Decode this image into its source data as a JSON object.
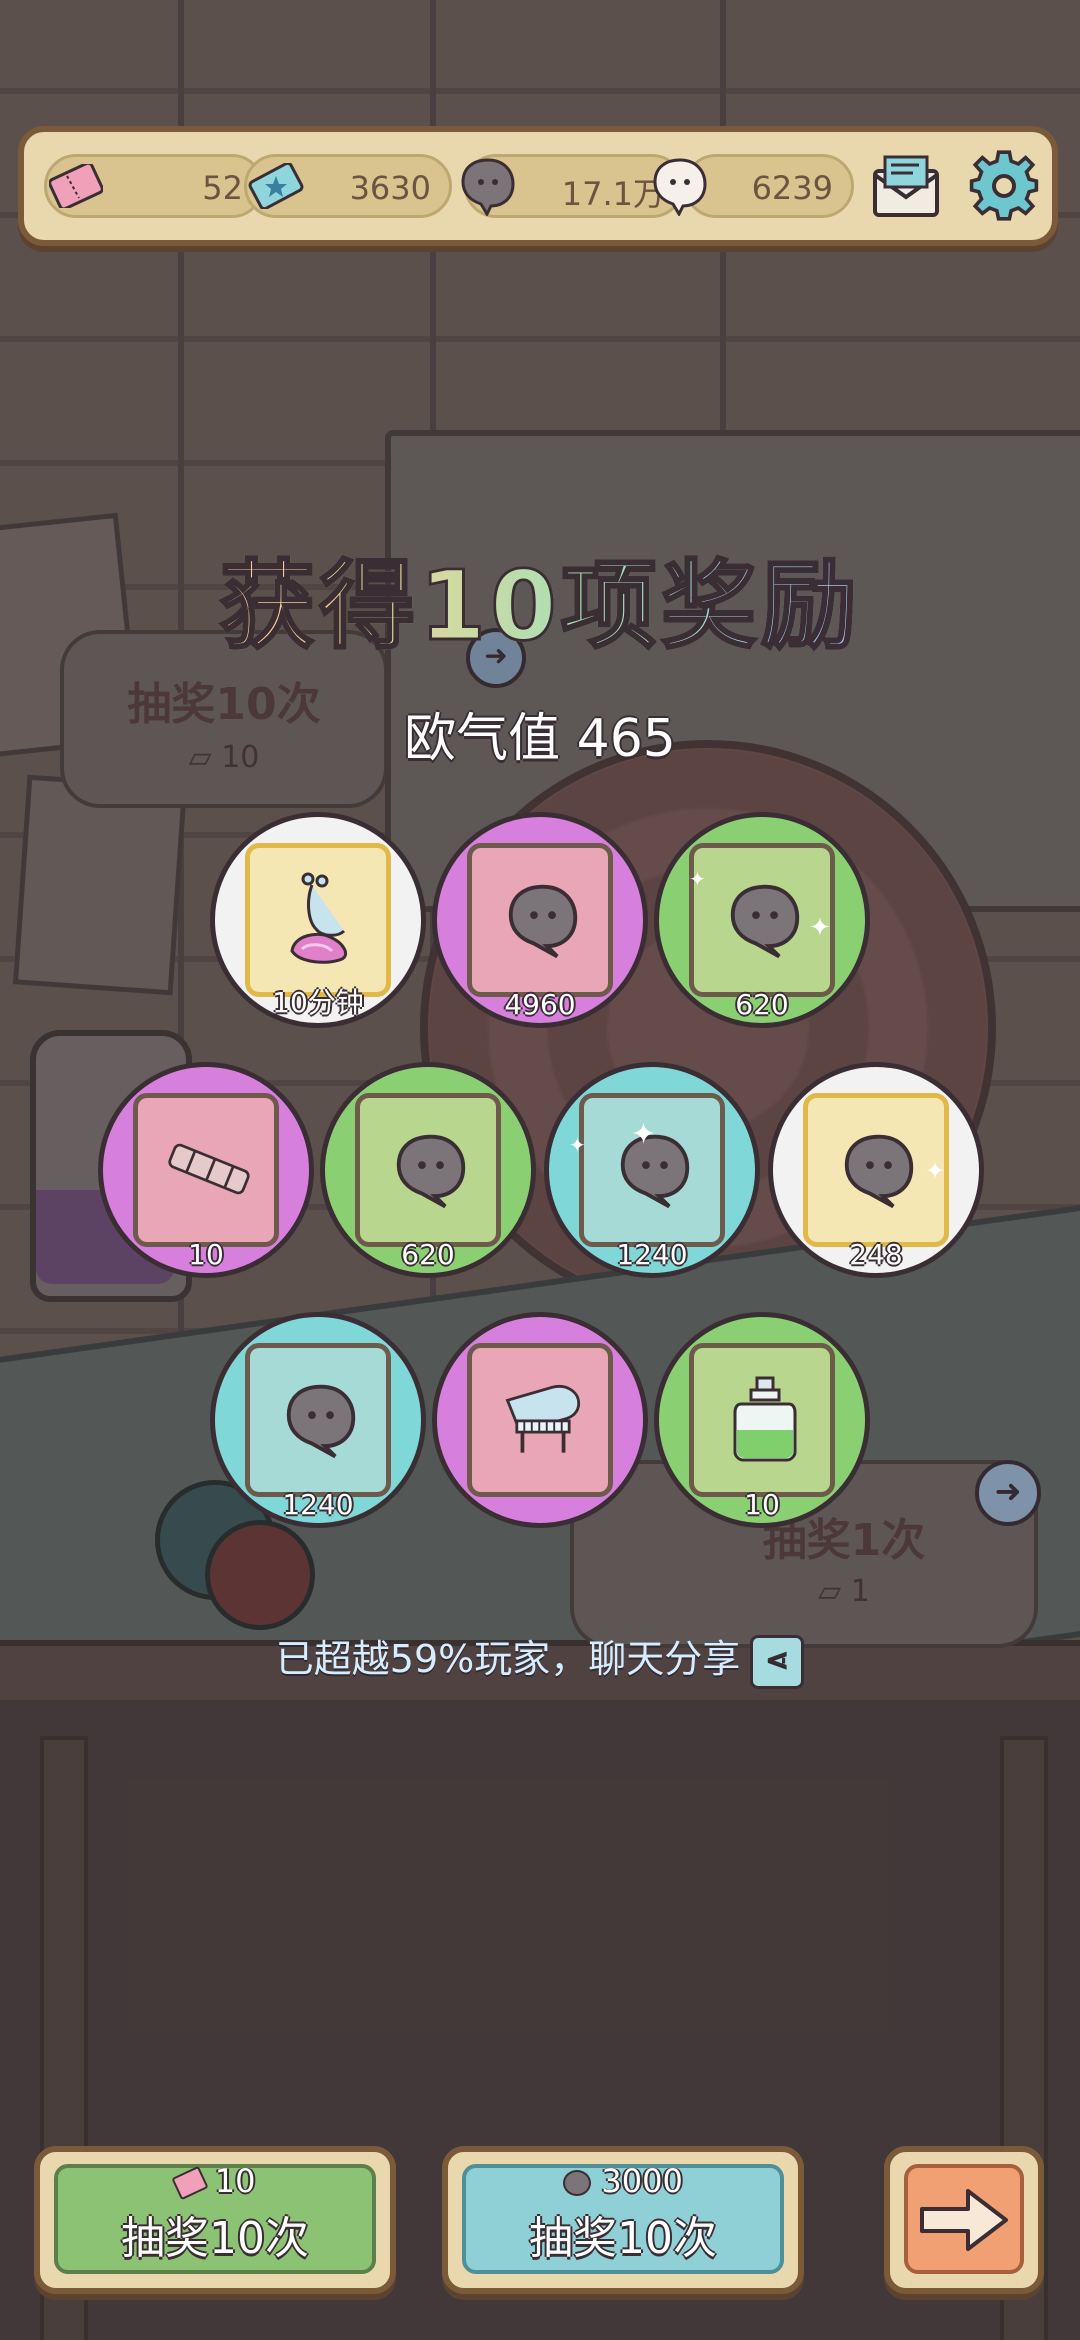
{
  "resources": [
    {
      "name": "ticket",
      "value": "52"
    },
    {
      "name": "star-ticket",
      "value": "3630"
    },
    {
      "name": "dark-bubble",
      "value": "17.1万"
    },
    {
      "name": "light-bubble",
      "value": "6239"
    }
  ],
  "title": "获得10项奖励",
  "luck_label": "欧气值 465",
  "rewards": [
    {
      "count": "10分钟",
      "item": "snail"
    },
    {
      "count": "4960",
      "item": "dark-bubble"
    },
    {
      "count": "620",
      "item": "dark-bubble"
    },
    {
      "count": "10",
      "item": "telescope"
    },
    {
      "count": "620",
      "item": "dark-bubble"
    },
    {
      "count": "1240",
      "item": "dark-bubble"
    },
    {
      "count": "248",
      "item": "dark-bubble"
    },
    {
      "count": "1240",
      "item": "dark-bubble"
    },
    {
      "count": "",
      "item": "piano"
    },
    {
      "count": "10",
      "item": "potion"
    }
  ],
  "background": {
    "draw10_label": "抽奖10次",
    "draw10_cost": "10",
    "draw1_label": "抽奖1次",
    "draw1_cost": "1"
  },
  "share_text": "已超越59%玩家，聊天分享",
  "buttons": {
    "ticket_draw": {
      "cost": "10",
      "label": "抽奖10次"
    },
    "bubble_draw": {
      "cost": "3000",
      "label": "抽奖10次"
    }
  },
  "colors": {
    "frame": "#7b5a3a",
    "panel": "#e9d8ae",
    "green_button": "#8cc274",
    "blue_button": "#8fd0d6",
    "orange_button": "#f1a073"
  }
}
